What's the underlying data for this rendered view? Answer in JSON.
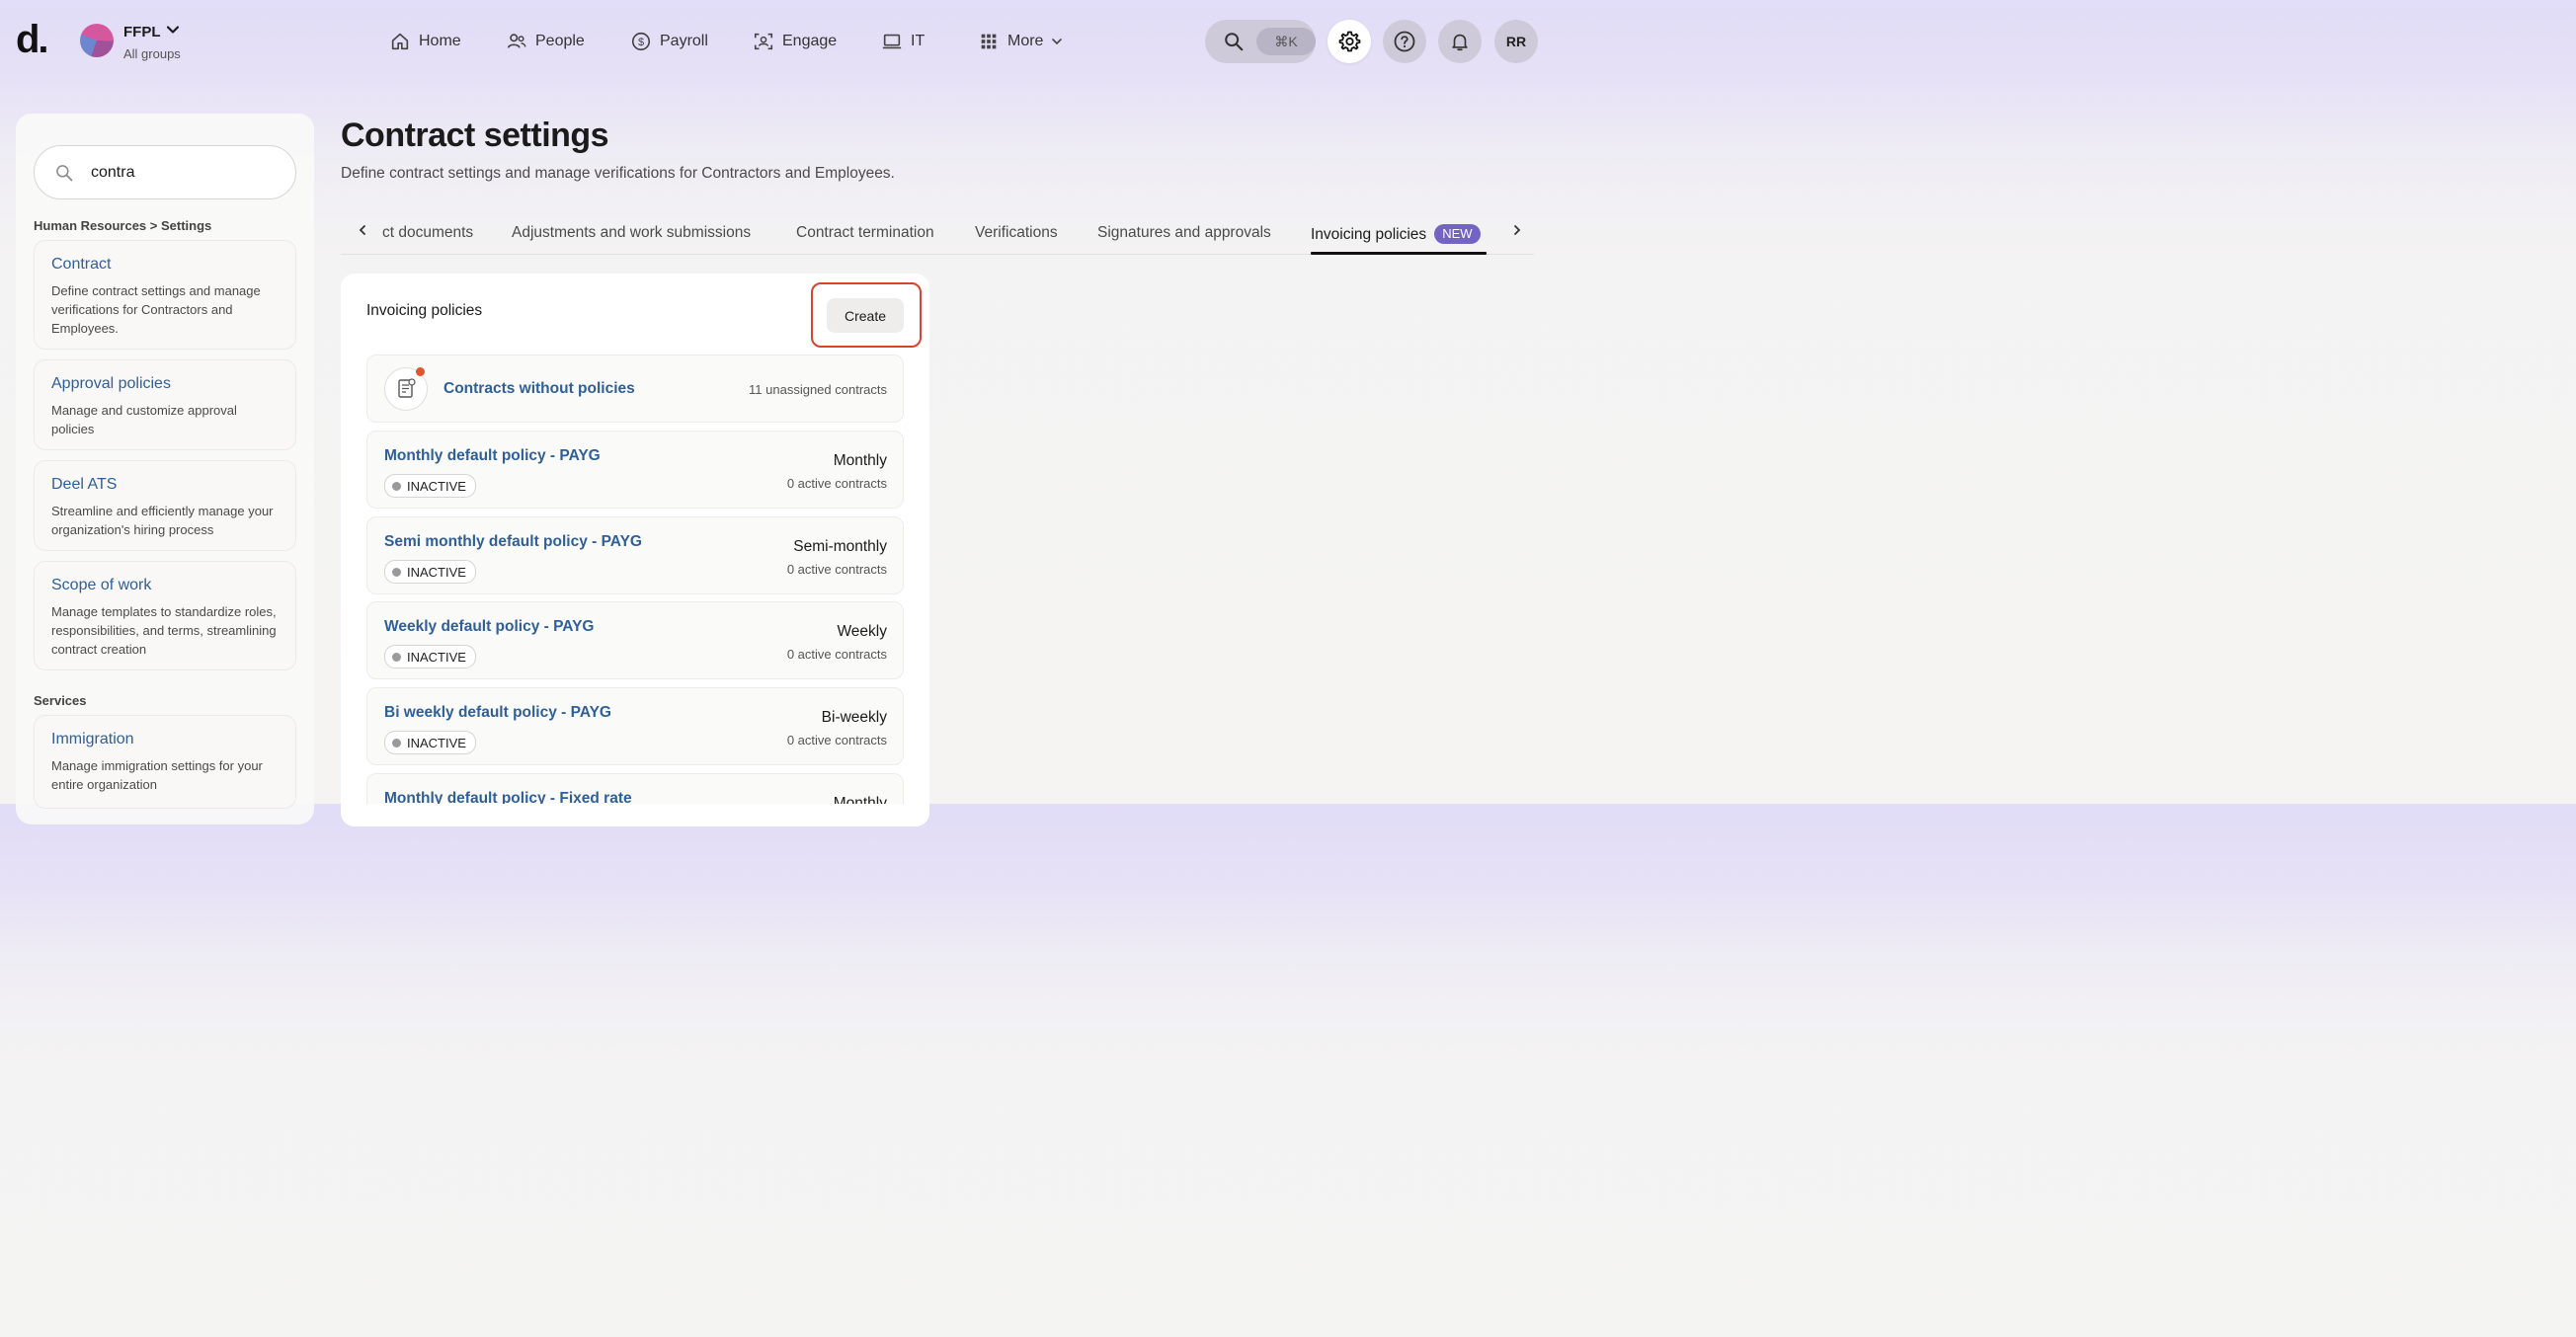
{
  "header": {
    "logo": "d.",
    "org_name": "FFPL",
    "org_sub": "All groups",
    "nav": [
      {
        "label": "Home",
        "icon": "home-icon"
      },
      {
        "label": "People",
        "icon": "people-icon"
      },
      {
        "label": "Payroll",
        "icon": "dollar-icon"
      },
      {
        "label": "Engage",
        "icon": "engage-icon"
      },
      {
        "label": "IT",
        "icon": "laptop-icon"
      },
      {
        "label": "More",
        "icon": "grid-icon"
      }
    ],
    "shortcut": "⌘K",
    "user_initials": "RR"
  },
  "sidebar": {
    "search_value": "contra",
    "section1": "Human Resources > Settings",
    "items": [
      {
        "title": "Contract",
        "desc": "Define contract settings and manage verifications for Contractors and Employees."
      },
      {
        "title": "Approval policies",
        "desc": "Manage and customize approval policies"
      },
      {
        "title": "Deel ATS",
        "desc": "Streamline and efficiently manage your organization's hiring process"
      },
      {
        "title": "Scope of work",
        "desc": "Manage templates to standardize roles, responsibilities, and terms, streamlining contract creation"
      }
    ],
    "section2": "Services",
    "services": [
      {
        "title": "Immigration",
        "desc": "Manage immigration settings for your entire organization"
      }
    ]
  },
  "main": {
    "title": "Contract settings",
    "description": "Define contract settings and manage verifications for Contractors and Employees.",
    "tabs": [
      {
        "label": "ct documents"
      },
      {
        "label": "Adjustments and work submissions"
      },
      {
        "label": "Contract termination"
      },
      {
        "label": "Verifications"
      },
      {
        "label": "Signatures and approvals"
      },
      {
        "label": "Invoicing policies",
        "badge": "NEW"
      }
    ],
    "panel": {
      "title": "Invoicing policies",
      "create_label": "Create",
      "no_policies": {
        "label": "Contracts without policies",
        "count": "11 unassigned contracts"
      },
      "policies": [
        {
          "name": "Monthly default policy - PAYG",
          "status": "INACTIVE",
          "frequency": "Monthly",
          "count": "0 active contracts"
        },
        {
          "name": "Semi monthly default policy - PAYG",
          "status": "INACTIVE",
          "frequency": "Semi-monthly",
          "count": "0 active contracts"
        },
        {
          "name": "Weekly default policy - PAYG",
          "status": "INACTIVE",
          "frequency": "Weekly",
          "count": "0 active contracts"
        },
        {
          "name": "Bi weekly default policy - PAYG",
          "status": "INACTIVE",
          "frequency": "Bi-weekly",
          "count": "0 active contracts"
        },
        {
          "name": "Monthly default policy - Fixed rate",
          "frequency": "Monthly"
        }
      ]
    }
  },
  "colors": {
    "link": "#2f5f98",
    "badge_new": "#7363c4",
    "highlight": "#d9422b",
    "notification_dot": "#e0552e"
  }
}
